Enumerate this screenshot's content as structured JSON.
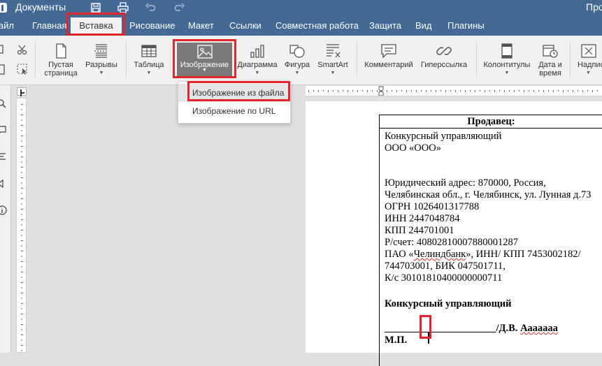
{
  "app": {
    "title": "Документы",
    "title_right": "Про"
  },
  "menu": {
    "tabs": [
      {
        "label": "Файл"
      },
      {
        "label": "Главная"
      },
      {
        "label": "Вставка"
      },
      {
        "label": "Рисование"
      },
      {
        "label": "Макет"
      },
      {
        "label": "Ссылки"
      },
      {
        "label": "Совместная работа"
      },
      {
        "label": "Защита"
      },
      {
        "label": "Вид"
      },
      {
        "label": "Плагины"
      }
    ],
    "active_tab": "Вставка"
  },
  "toolbar": {
    "blank_page": "Пустая\nстраница",
    "breaks": "Разрывы",
    "table": "Таблица",
    "image": "Изображение",
    "chart": "Диаграмма",
    "shape": "Фигура",
    "smartart": "SmartArt",
    "comment": "Комментарий",
    "hyperlink": "Гиперссылка",
    "headers_footers": "Колонтитулы",
    "date_time": "Дата и\nвремя",
    "text_box": "Надпис"
  },
  "image_menu": {
    "from_file": "Изображение из файла",
    "from_url": "Изображение по URL"
  },
  "document": {
    "header": "Продавец:",
    "lines": [
      "Конкурсный управляющий",
      "ООО «ООО»",
      "",
      "",
      "Юридический адрес: 870000, Россия,",
      "Челябинская обл., г. Челябинск, ул. Лунная д.73",
      "ОГРН 1026401317788",
      "ИНН 2447048784",
      "КПП 244701001",
      "Р/счет: 40802810007880001287"
    ],
    "bank_prefix": "ПАО «",
    "bank_name": "Челиндбанк",
    "bank_suffix": "», ИНН/ КПП 7453002182/",
    "bik_line": "744703001, БИК 047501711,",
    "ks_line": "К/с 30101810400000000711",
    "manager_bold": "Конкурсный управляющий",
    "signature_line": "______________________/Д.В. ",
    "signature_name": "Ааааааа",
    "stamp": "М.П."
  },
  "colors": {
    "header_blue": "#446995",
    "highlight_red": "#e0252e"
  }
}
